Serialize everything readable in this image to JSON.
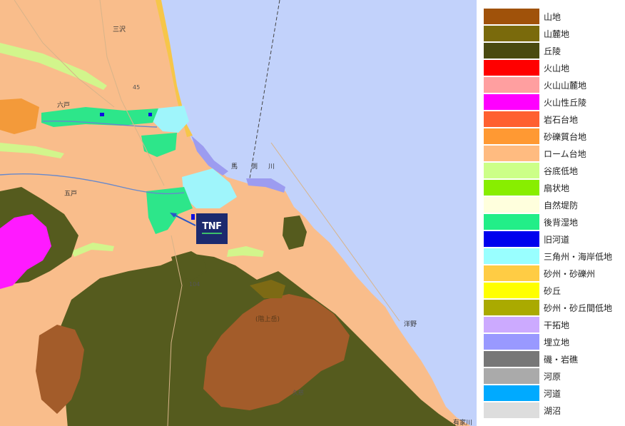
{
  "map": {
    "marker": {
      "label": "TNF"
    },
    "place_labels": {
      "misawa": "三沢",
      "rokunohe": "六戸",
      "gonohe": "五戸",
      "mabechi": "馬",
      "mabechi2": "渕",
      "mabechi3": "川",
      "hirono": "洋野",
      "arigegawa": "有家川",
      "hashikami": "(階上岳)",
      "kuji": "久慈",
      "route45": "45",
      "route104": "104"
    }
  },
  "legend": {
    "items": [
      {
        "label": "山地",
        "color": "#a0520a"
      },
      {
        "label": "山麓地",
        "color": "#7a6a0c"
      },
      {
        "label": "丘陵",
        "color": "#4a4a10"
      },
      {
        "label": "火山地",
        "color": "#ff0000"
      },
      {
        "label": "火山山麓地",
        "color": "#ff9fa0"
      },
      {
        "label": "火山性丘陵",
        "color": "#ff00ff"
      },
      {
        "label": "岩石台地",
        "color": "#ff6030"
      },
      {
        "label": "砂礫質台地",
        "color": "#ff9933"
      },
      {
        "label": "ローム台地",
        "color": "#ffbb80"
      },
      {
        "label": "谷底低地",
        "color": "#ccff88"
      },
      {
        "label": "扇状地",
        "color": "#88ee00"
      },
      {
        "label": "自然堤防",
        "color": "#ffffdd"
      },
      {
        "label": "後背湿地",
        "color": "#22ee88"
      },
      {
        "label": "旧河道",
        "color": "#0000ee"
      },
      {
        "label": "三角州・海岸低地",
        "color": "#99ffff"
      },
      {
        "label": "砂州・砂礫州",
        "color": "#ffcc44"
      },
      {
        "label": "砂丘",
        "color": "#ffff00"
      },
      {
        "label": "砂州・砂丘間低地",
        "color": "#aaaa00"
      },
      {
        "label": "干拓地",
        "color": "#ccaaff"
      },
      {
        "label": "埋立地",
        "color": "#9999ff"
      },
      {
        "label": "磯・岩礁",
        "color": "#777777"
      },
      {
        "label": "河原",
        "color": "#aaaaaa"
      },
      {
        "label": "河道",
        "color": "#00aaff"
      },
      {
        "label": "湖沼",
        "color": "#dddddd"
      }
    ]
  }
}
